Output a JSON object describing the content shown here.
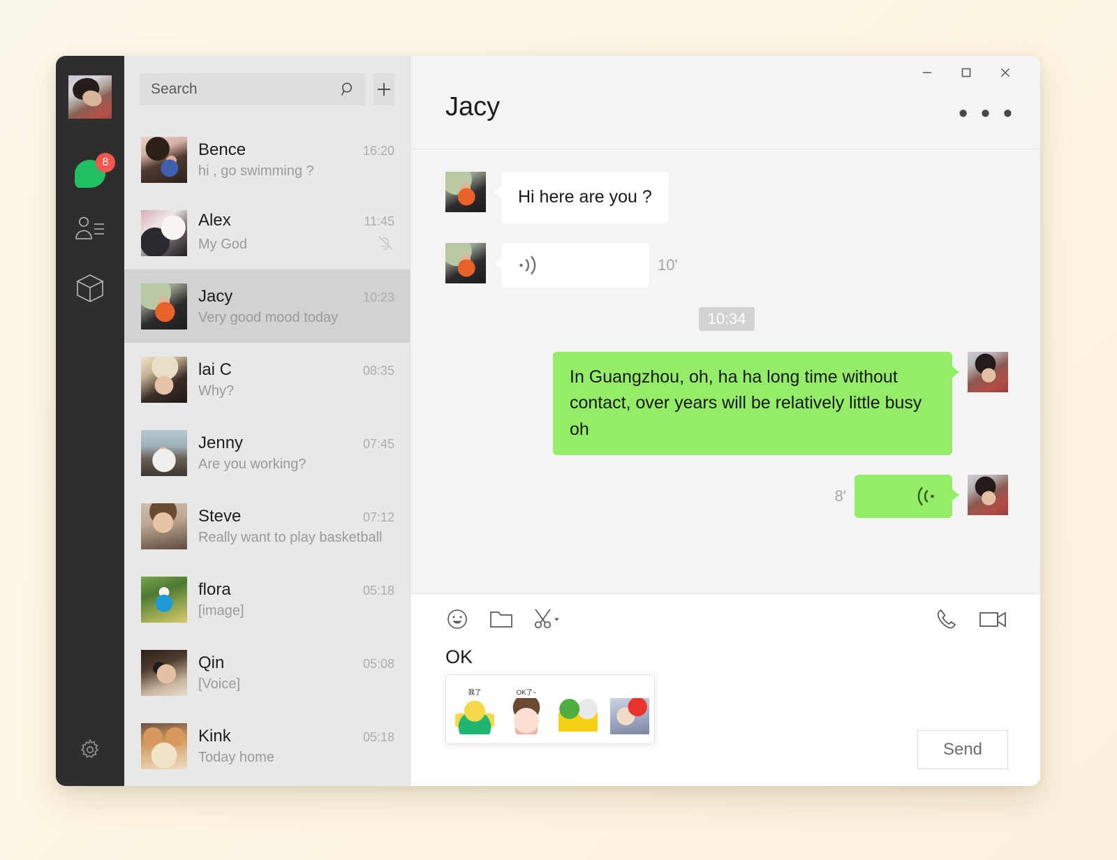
{
  "window": {
    "controls": {
      "minimize": "minimize-button",
      "maximize": "maximize-button",
      "close": "close-button"
    },
    "more_label": "• • •"
  },
  "nav_rail": {
    "avatar_name": "user-avatar",
    "items": [
      {
        "id": "chats",
        "label": "Chats",
        "icon": "chat-bubble-icon",
        "badge": "8",
        "active": true
      },
      {
        "id": "contacts",
        "label": "Contacts",
        "icon": "contacts-icon",
        "badge": "",
        "active": false
      },
      {
        "id": "favorites",
        "label": "Favorites",
        "icon": "box-icon",
        "badge": "",
        "active": false
      }
    ],
    "settings": {
      "label": "Settings",
      "icon": "gear-icon"
    }
  },
  "sidebar": {
    "search": {
      "placeholder": "Search",
      "value": "",
      "icon": "search-icon"
    },
    "add_button": {
      "label": "+",
      "icon": "plus-icon"
    },
    "chats": [
      {
        "name": "Bence",
        "time": "16:20",
        "preview": "hi , go swimming ?",
        "avatar_class": "av-bence",
        "selected": false,
        "muted": false
      },
      {
        "name": "Alex",
        "time": "11:45",
        "preview": "My God",
        "avatar_class": "av-alex",
        "selected": false,
        "muted": true
      },
      {
        "name": "Jacy",
        "time": "10:23",
        "preview": "Very good mood today",
        "avatar_class": "av-jacy",
        "selected": true,
        "muted": false
      },
      {
        "name": "lai C",
        "time": "08:35",
        "preview": "Why?",
        "avatar_class": "av-laic",
        "selected": false,
        "muted": false
      },
      {
        "name": "Jenny",
        "time": "07:45",
        "preview": "Are you working?",
        "avatar_class": "av-jenny",
        "selected": false,
        "muted": false
      },
      {
        "name": "Steve",
        "time": "07:12",
        "preview": "Really want to play basketball",
        "avatar_class": "av-steve",
        "selected": false,
        "muted": false
      },
      {
        "name": "flora",
        "time": "05:18",
        "preview": "[image]",
        "avatar_class": "av-flora",
        "selected": false,
        "muted": false
      },
      {
        "name": "Qin",
        "time": "05:08",
        "preview": "[Voice]",
        "avatar_class": "av-qin",
        "selected": false,
        "muted": false
      },
      {
        "name": "Kink",
        "time": "05:18",
        "preview": "Today home",
        "avatar_class": "av-kink",
        "selected": false,
        "muted": false
      }
    ]
  },
  "conversation": {
    "title": "Jacy",
    "timestamp_divider": "10:34",
    "messages": [
      {
        "id": "m1",
        "dir": "in",
        "type": "text",
        "text": "Hi here are you ?",
        "avatar_class": "av-jacy"
      },
      {
        "id": "m2",
        "dir": "in",
        "type": "voice",
        "duration": "10'",
        "icon": "voice-wave-icon",
        "avatar_class": "av-jacy"
      },
      {
        "id": "m3",
        "dir": "out",
        "type": "text",
        "text": "In Guangzhou, oh, ha ha long time without contact, over years will be relatively little busy oh",
        "avatar_class": "av-me"
      },
      {
        "id": "m4",
        "dir": "out",
        "type": "voice",
        "duration": "8'",
        "icon": "voice-wave-icon",
        "avatar_class": "av-me"
      }
    ]
  },
  "composer": {
    "tools_left": [
      {
        "id": "emoji",
        "icon": "emoji-icon",
        "label": "Emoji"
      },
      {
        "id": "file",
        "icon": "folder-icon",
        "label": "Send File"
      },
      {
        "id": "screenshot",
        "icon": "scissors-icon",
        "label": "Screenshot"
      }
    ],
    "tools_right": [
      {
        "id": "voice-call",
        "icon": "phone-icon",
        "label": "Voice Call"
      },
      {
        "id": "video-call",
        "icon": "video-icon",
        "label": "Video Call"
      }
    ],
    "text": "OK",
    "send_label": "Send",
    "sticker_suggestions": [
      {
        "caption": "我了",
        "art_class": "st1",
        "name": "sticker-flex-face"
      },
      {
        "caption": "OK了~",
        "art_class": "st2",
        "name": "sticker-granny"
      },
      {
        "caption": "",
        "art_class": "st3",
        "name": "sticker-ok-duo"
      },
      {
        "caption": "",
        "art_class": "st4",
        "name": "sticker-person"
      }
    ]
  },
  "colors": {
    "accent_green": "#95EC69",
    "brand_green": "#21C063",
    "badge_red": "#F5564F",
    "rail_dark": "#2E2E2E",
    "list_bg": "#E8E8E8",
    "selected_row": "#D2D2D2",
    "page_bg": "#FDF6E4"
  }
}
